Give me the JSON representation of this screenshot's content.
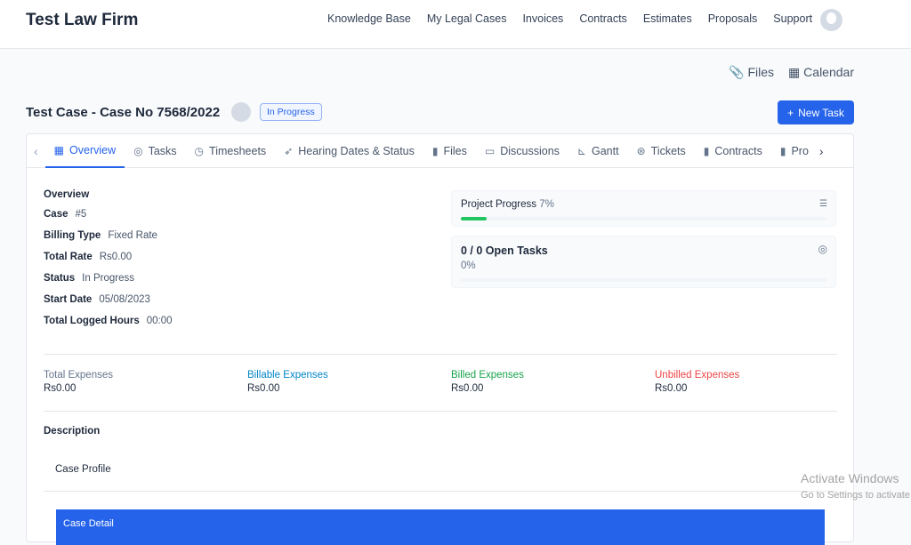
{
  "header": {
    "brand": "Test Law Firm",
    "nav": [
      "Knowledge Base",
      "My Legal Cases",
      "Invoices",
      "Contracts",
      "Estimates",
      "Proposals",
      "Support"
    ]
  },
  "toplinks": {
    "files": "Files",
    "calendar": "Calendar"
  },
  "case": {
    "title": "Test Case - Case No 7568/2022",
    "status": "In Progress",
    "new_task": "New Task"
  },
  "tabs": [
    {
      "label": "Overview",
      "icon": "grid-icon"
    },
    {
      "label": "Tasks",
      "icon": "check-circle-icon"
    },
    {
      "label": "Timesheets",
      "icon": "clock-icon"
    },
    {
      "label": "Hearing Dates & Status",
      "icon": "rocket-icon"
    },
    {
      "label": "Files",
      "icon": "file-icon"
    },
    {
      "label": "Discussions",
      "icon": "comment-icon"
    },
    {
      "label": "Gantt",
      "icon": "chart-icon"
    },
    {
      "label": "Tickets",
      "icon": "lifering-icon"
    },
    {
      "label": "Contracts",
      "icon": "contract-icon"
    },
    {
      "label": "Pro",
      "icon": "file-icon"
    }
  ],
  "overview": {
    "heading": "Overview",
    "fields": [
      {
        "label": "Case",
        "value": "#5"
      },
      {
        "label": "Billing Type",
        "value": "Fixed Rate"
      },
      {
        "label": "Total Rate",
        "value": "Rs0.00"
      },
      {
        "label": "Status",
        "value": "In Progress"
      },
      {
        "label": "Start Date",
        "value": "05/08/2023"
      },
      {
        "label": "Total Logged Hours",
        "value": "00:00"
      }
    ]
  },
  "progress": {
    "label": "Project Progress",
    "percent_text": "7%",
    "percent": 7,
    "color": "#22c55e"
  },
  "tasks": {
    "label": "0 / 0 Open Tasks",
    "percent_text": "0%",
    "percent": 0
  },
  "expenses": [
    {
      "label": "Total Expenses",
      "value": "Rs0.00",
      "color": "#64748b"
    },
    {
      "label": "Billable Expenses",
      "value": "Rs0.00",
      "color": "#0284c7"
    },
    {
      "label": "Billed Expenses",
      "value": "Rs0.00",
      "color": "#16a34a"
    },
    {
      "label": "Unbilled Expenses",
      "value": "Rs0.00",
      "color": "#ef4444"
    }
  ],
  "description": {
    "heading": "Description",
    "case_profile": "Case Profile",
    "case_detail": "Case Detail"
  },
  "watermark": {
    "title": "Activate Windows",
    "subtitle": "Go to Settings to activate Windows."
  }
}
